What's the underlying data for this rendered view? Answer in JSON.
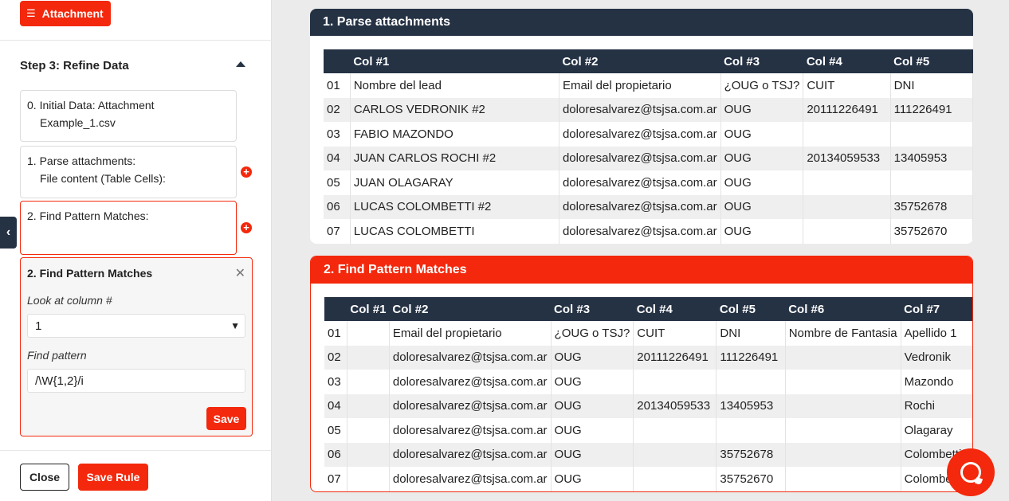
{
  "sidebar": {
    "attachment_button": "Attachment",
    "step_title": "Step 3: Refine Data",
    "cards": [
      {
        "line1": "0. Initial Data: Attachment",
        "line2": "Example_1.csv"
      },
      {
        "line1": "1. Parse attachments:",
        "line2": "File content (Table Cells):"
      },
      {
        "line1": "2. Find Pattern Matches:",
        "line2": ""
      }
    ],
    "editor": {
      "title": "2. Find Pattern Matches",
      "column_label": "Look at column #",
      "column_value": "1",
      "pattern_label": "Find pattern",
      "pattern_value": "/\\W{1,2}/i",
      "save_label": "Save"
    },
    "close_label": "Close",
    "save_rule_label": "Save Rule"
  },
  "panel1": {
    "title": "1. Parse attachments",
    "columns": [
      "",
      "Col #1",
      "Col #2",
      "Col #3",
      "Col #4",
      "Col #5"
    ],
    "rows": [
      [
        "01",
        "Nombre del lead",
        "Email del propietario",
        "¿OUG o TSJ?",
        "CUIT",
        "DNI"
      ],
      [
        "02",
        "CARLOS VEDRONIK #2",
        "doloresalvarez@tsjsa.com.ar",
        "OUG",
        "20111226491",
        "111226491"
      ],
      [
        "03",
        "FABIO MAZONDO",
        "doloresalvarez@tsjsa.com.ar",
        "OUG",
        "",
        ""
      ],
      [
        "04",
        "JUAN CARLOS ROCHI #2",
        "doloresalvarez@tsjsa.com.ar",
        "OUG",
        "20134059533",
        "13405953"
      ],
      [
        "05",
        "JUAN OLAGARAY",
        "doloresalvarez@tsjsa.com.ar",
        "OUG",
        "",
        ""
      ],
      [
        "06",
        "LUCAS COLOMBETTI #2",
        "doloresalvarez@tsjsa.com.ar",
        "OUG",
        "",
        "35752678"
      ],
      [
        "07",
        "LUCAS COLOMBETTI",
        "doloresalvarez@tsjsa.com.ar",
        "OUG",
        "",
        "35752670"
      ]
    ]
  },
  "panel2": {
    "title": "2. Find Pattern Matches",
    "columns": [
      "",
      "Col #1",
      "Col #2",
      "Col #3",
      "Col #4",
      "Col #5",
      "Col #6",
      "Col #7"
    ],
    "rows": [
      [
        "01",
        "",
        "Email del propietario",
        "¿OUG o TSJ?",
        "CUIT",
        "DNI",
        "Nombre de Fantasia",
        "Apellido 1"
      ],
      [
        "02",
        "",
        "doloresalvarez@tsjsa.com.ar",
        "OUG",
        "20111226491",
        "111226491",
        "",
        "Vedronik"
      ],
      [
        "03",
        "",
        "doloresalvarez@tsjsa.com.ar",
        "OUG",
        "",
        "",
        "",
        "Mazondo"
      ],
      [
        "04",
        "",
        "doloresalvarez@tsjsa.com.ar",
        "OUG",
        "20134059533",
        "13405953",
        "",
        "Rochi"
      ],
      [
        "05",
        "",
        "doloresalvarez@tsjsa.com.ar",
        "OUG",
        "",
        "",
        "",
        "Olagaray"
      ],
      [
        "06",
        "",
        "doloresalvarez@tsjsa.com.ar",
        "OUG",
        "",
        "35752678",
        "",
        "Colombetti"
      ],
      [
        "07",
        "",
        "doloresalvarez@tsjsa.com.ar",
        "OUG",
        "",
        "35752670",
        "",
        "Colombetti"
      ]
    ]
  },
  "colors": {
    "accent": "#f3280c",
    "dark": "#253244"
  },
  "icons": {
    "attachment": "list-icon",
    "collapse": "chevron-left-icon",
    "chat": "chat-icon"
  }
}
